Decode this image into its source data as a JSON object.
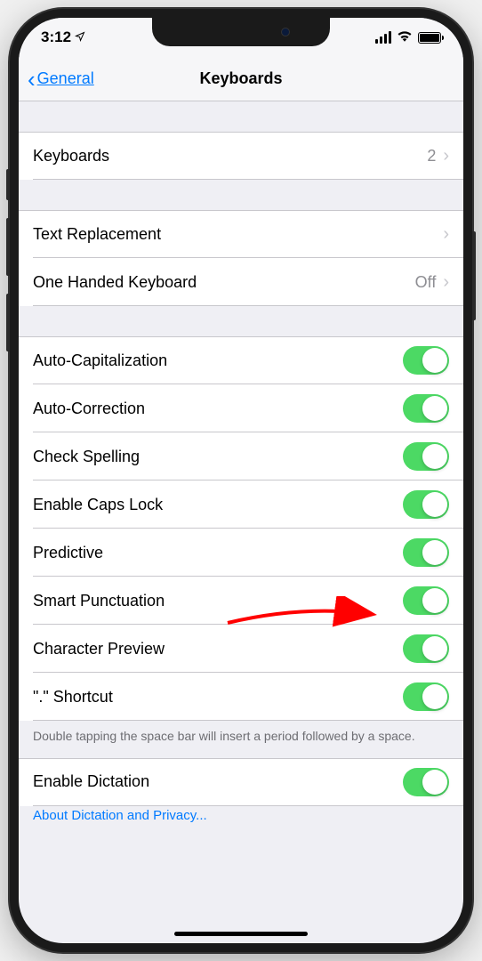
{
  "statusBar": {
    "time": "3:12"
  },
  "nav": {
    "back": "General",
    "title": "Keyboards"
  },
  "rows": {
    "keyboards": {
      "label": "Keyboards",
      "value": "2"
    },
    "textReplacement": {
      "label": "Text Replacement"
    },
    "oneHanded": {
      "label": "One Handed Keyboard",
      "value": "Off"
    },
    "autoCap": {
      "label": "Auto-Capitalization"
    },
    "autoCorrect": {
      "label": "Auto-Correction"
    },
    "checkSpelling": {
      "label": "Check Spelling"
    },
    "capsLock": {
      "label": "Enable Caps Lock"
    },
    "predictive": {
      "label": "Predictive"
    },
    "smartPunct": {
      "label": "Smart Punctuation"
    },
    "charPreview": {
      "label": "Character Preview"
    },
    "shortcut": {
      "label": "\".\" Shortcut"
    },
    "dictation": {
      "label": "Enable Dictation"
    }
  },
  "footer": {
    "shortcut": "Double tapping the space bar will insert a period followed by a space.",
    "dictationLink": "About Dictation and Privacy..."
  },
  "colors": {
    "link": "#007aff",
    "toggleOn": "#4cd964",
    "annotationArrow": "#ff0000"
  }
}
